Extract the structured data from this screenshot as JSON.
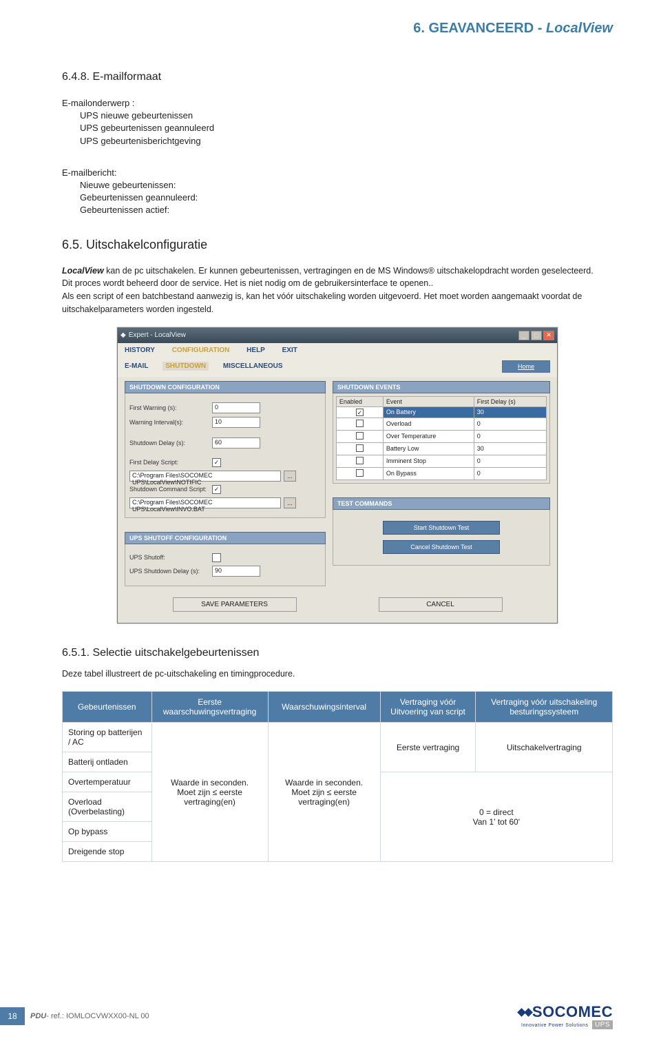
{
  "chapter": {
    "num": "6.",
    "title": "GEAVANCEERD - ",
    "italic": "LocalView"
  },
  "sec648": {
    "title": "6.4.8.  E-mailformaat",
    "subj_label": "E-mailonderwerp :",
    "subj_items": [
      "UPS nieuwe gebeurtenissen",
      "UPS gebeurtenissen geannuleerd",
      "UPS gebeurtenisberichtgeving"
    ],
    "msg_label": "E-mailbericht:",
    "msg_items": [
      "Nieuwe gebeurtenissen:",
      "Gebeurtenissen geannuleerd:",
      "Gebeurtenissen actief:"
    ]
  },
  "sec65": {
    "title": "6.5.  Uitschakelconfiguratie",
    "para": " kan de pc uitschakelen. Er kunnen gebeurtenissen, vertragingen en de MS Windows® uitschakelopdracht worden geselecteerd.\nDit proces wordt beheerd door de service. Het is niet nodig om de gebruikersinterface te openen..\nAls een script of een batchbestand aanwezig is, kan het vóór uitschakeling worden uitgevoerd. Het moet worden aangemaakt voordat de uitschakelparameters worden ingesteld.",
    "lead": "LocalView"
  },
  "screenshot": {
    "wintitle": "Expert - LocalView",
    "menus": [
      "HISTORY",
      "CONFIGURATION",
      "HELP",
      "EXIT"
    ],
    "submenus": [
      "E-MAIL",
      "SHUTDOWN",
      "MISCELLANEOUS"
    ],
    "home": "Home",
    "left": {
      "title1": "SHUTDOWN CONFIGURATION",
      "fw_label": "First Warning (s):",
      "fw_val": "0",
      "wi_label": "Warning Interval(s):",
      "wi_val": "10",
      "sd_label": "Shutdown Delay (s):",
      "sd_val": "60",
      "fds_label": "First Delay Script:",
      "fds_path": "C:\\Program Files\\SOCOMEC UPS\\LocalView\\NOTIFIC",
      "scs_label": "Shutdown Command Script:",
      "scs_path": "C:\\Program Files\\SOCOMEC UPS\\LocalView\\INVO.BAT",
      "title2": "UPS SHUTOFF CONFIGURATION",
      "uso_label": "UPS Shutoff:",
      "usd_label": "UPS Shutdown Delay (s):",
      "usd_val": "90"
    },
    "right": {
      "title1": "SHUTDOWN EVENTS",
      "cols": [
        "Enabled",
        "Event",
        "First Delay (s)"
      ],
      "rows": [
        {
          "enabled": true,
          "event": "On Battery",
          "delay": "30",
          "hl": true
        },
        {
          "enabled": false,
          "event": "Overload",
          "delay": "0"
        },
        {
          "enabled": false,
          "event": "Over Temperature",
          "delay": "0"
        },
        {
          "enabled": false,
          "event": "Battery Low",
          "delay": "30"
        },
        {
          "enabled": false,
          "event": "Imminent Stop",
          "delay": "0"
        },
        {
          "enabled": false,
          "event": "On Bypass",
          "delay": "0"
        }
      ],
      "title2": "TEST COMMANDS",
      "btn1": "Start Shutdown Test",
      "btn2": "Cancel Shutdown Test"
    },
    "save": "SAVE PARAMETERS",
    "cancel": "CANCEL"
  },
  "sec651": {
    "title": "6.5.1.  Selectie uitschakelgebeurtenissen",
    "intro": "Deze tabel illustreert de pc-uitschakeling en timingprocedure.",
    "headers": [
      "Gebeurtenissen",
      "Eerste waarschuwingsvertraging",
      "Waarschuwingsinterval",
      "Vertraging vóór Uitvoering van script",
      "Vertraging vóór uitschakeling besturingssysteem"
    ],
    "events": [
      "Storing op batterijen / AC",
      "Batterij ontladen",
      "Overtemperatuur",
      "Overload (Overbelasting)",
      "Op bypass",
      "Dreigende stop"
    ],
    "c2": "Waarde in seconden.\nMoet zijn ≤ eerste vertraging(en)",
    "c3": "Waarde in seconden.\nMoet zijn ≤ eerste vertraging(en)",
    "c4a": "Eerste vertraging",
    "c4b": "0 = direct\nVan 1' tot 60'",
    "c5a": "Uitschakelvertraging"
  },
  "footer": {
    "page": "18",
    "ref": " - ref.: IOMLOCVWXX00-NL  00",
    "pdu": "PDU",
    "brand": "SOCOMEC",
    "tag": "Innovative Power Solutions",
    "ups": "UPS"
  }
}
